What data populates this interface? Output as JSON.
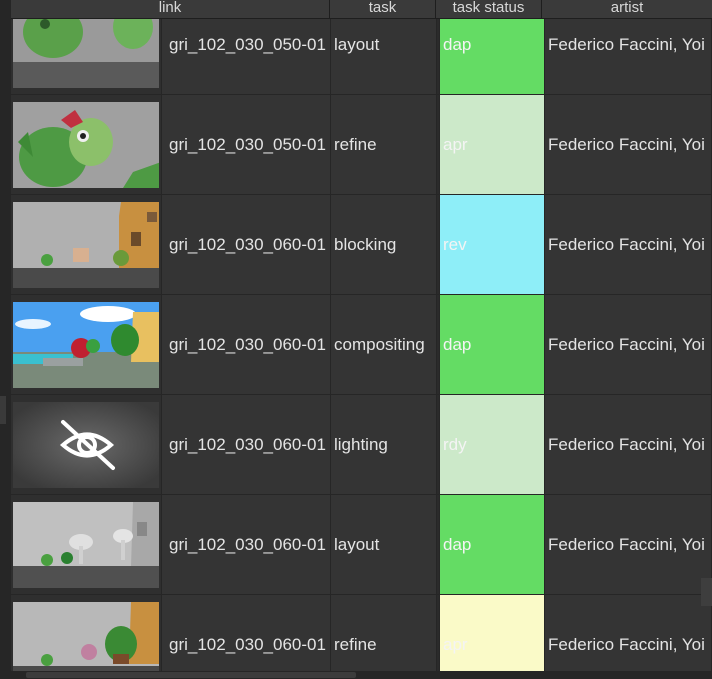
{
  "columns": {
    "link": "link",
    "task": "task",
    "status": "task status",
    "artist": "artist"
  },
  "rows": [
    {
      "link": "gri_102_030_050-01",
      "task": "layout",
      "status": "dap",
      "status_color": "#64dc64",
      "artist": "Federico Faccini, Yoi",
      "thumb": "character-closeup"
    },
    {
      "link": "gri_102_030_050-01",
      "task": "refine",
      "status": "apr",
      "status_color": "#cce9c9",
      "artist": "Federico Faccini, Yoi",
      "thumb": "character-closeup-flower"
    },
    {
      "link": "gri_102_030_060-01",
      "task": "blocking",
      "status": "rev",
      "status_color": "#8eeef8",
      "artist": "Federico Faccini, Yoi",
      "thumb": "street-house"
    },
    {
      "link": "gri_102_030_060-01",
      "task": "compositing",
      "status": "dap",
      "status_color": "#64dc64",
      "artist": "Federico Faccini, Yoi",
      "thumb": "colored-street"
    },
    {
      "link": "gri_102_030_060-01",
      "task": "lighting",
      "status": "rdy",
      "status_color": "#cce9c9",
      "artist": "Federico Faccini, Yoi",
      "thumb": "no-preview"
    },
    {
      "link": "gri_102_030_060-01",
      "task": "layout",
      "status": "dap",
      "status_color": "#64dc64",
      "artist": "Federico Faccini, Yoi",
      "thumb": "grey-street"
    },
    {
      "link": "gri_102_030_060-01",
      "task": "refine",
      "status": "apr",
      "status_color": "#fafac8",
      "artist": "Federico Faccini, Yoi",
      "thumb": "street-house-2"
    }
  ]
}
